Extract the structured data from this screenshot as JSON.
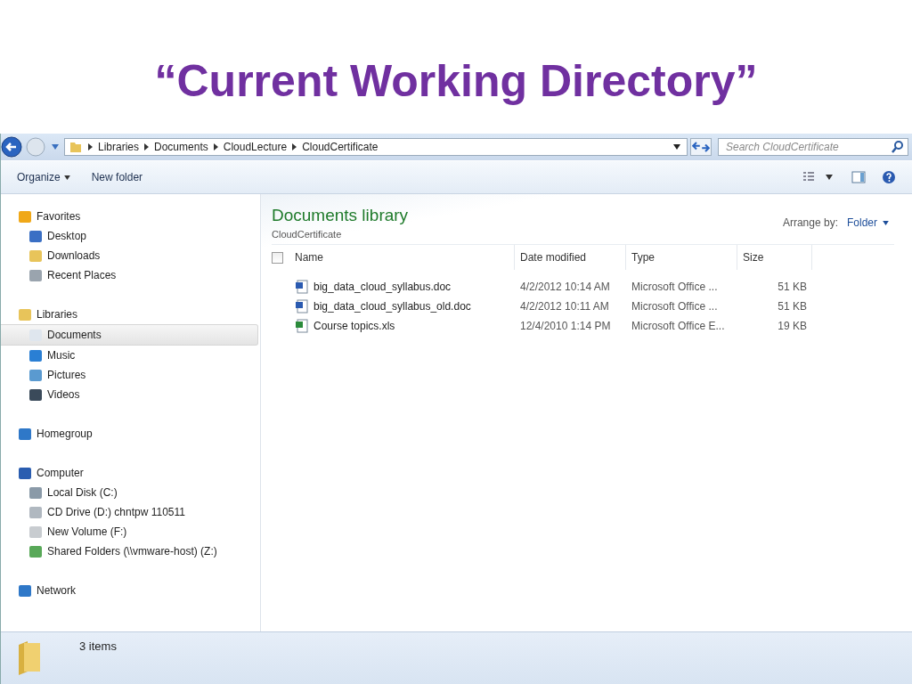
{
  "slide_title": "“Current Working Directory”",
  "address_bar": {
    "breadcrumbs": [
      "Libraries",
      "Documents",
      "CloudLecture",
      "CloudCertificate"
    ]
  },
  "search": {
    "placeholder": "Search CloudCertificate"
  },
  "toolbar": {
    "organize": "Organize",
    "new_folder": "New folder"
  },
  "sidebar": {
    "groups": [
      {
        "label": "Favorites",
        "children": [
          {
            "label": "Desktop",
            "selected": false
          },
          {
            "label": "Downloads",
            "selected": false
          },
          {
            "label": "Recent Places",
            "selected": false
          }
        ]
      },
      {
        "label": "Libraries",
        "children": [
          {
            "label": "Documents",
            "selected": true
          },
          {
            "label": "Music",
            "selected": false
          },
          {
            "label": "Pictures",
            "selected": false
          },
          {
            "label": "Videos",
            "selected": false
          }
        ]
      },
      {
        "label": "Homegroup"
      },
      {
        "label": "Computer",
        "children": [
          {
            "label": "Local Disk (C:)",
            "selected": false
          },
          {
            "label": "CD Drive (D:) chntpw 110511",
            "selected": false
          },
          {
            "label": "New Volume (F:)",
            "selected": false
          },
          {
            "label": "Shared Folders (\\\\vmware-host) (Z:)",
            "selected": false
          }
        ]
      },
      {
        "label": "Network"
      }
    ]
  },
  "library": {
    "title": "Documents library",
    "subtitle": "CloudCertificate",
    "arrange_label": "Arrange by:",
    "arrange_value": "Folder"
  },
  "table": {
    "select_all": {
      "checked": false
    },
    "columns": [
      "Name",
      "Date modified",
      "Type",
      "Size"
    ],
    "rows": [
      {
        "kind": "word",
        "name": "big_data_cloud_syllabus.doc",
        "date": "4/2/2012 10:14 AM",
        "type": "Microsoft Office ...",
        "size": "51 KB"
      },
      {
        "kind": "word",
        "name": "big_data_cloud_syllabus_old.doc",
        "date": "4/2/2012 10:11 AM",
        "type": "Microsoft Office ...",
        "size": "51 KB"
      },
      {
        "kind": "excel",
        "name": "Course topics.xls",
        "date": "12/4/2010 1:14 PM",
        "type": "Microsoft Office E...",
        "size": "19 KB"
      }
    ]
  },
  "status_bar": {
    "count": "3 items"
  }
}
